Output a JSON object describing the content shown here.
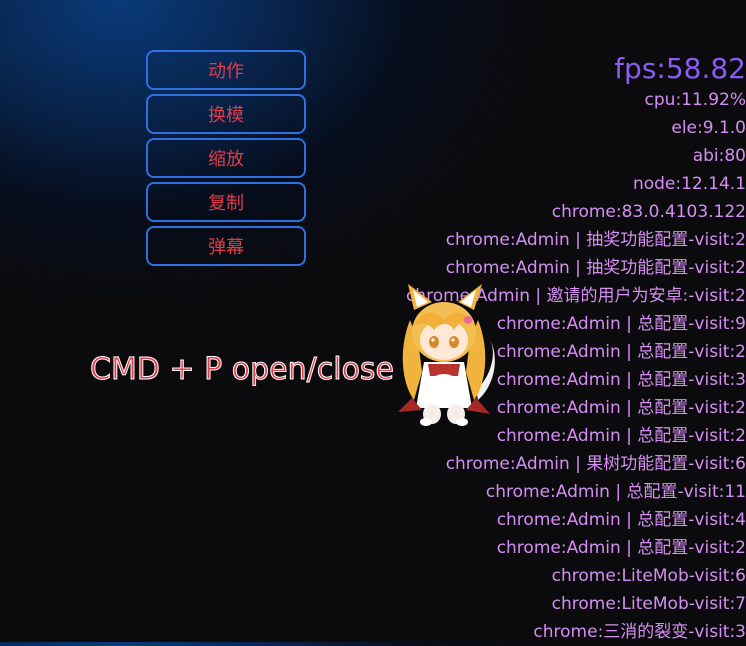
{
  "menu": {
    "items": [
      {
        "label": "动作"
      },
      {
        "label": "换模"
      },
      {
        "label": "缩放"
      },
      {
        "label": "复制"
      },
      {
        "label": "弹幕"
      }
    ]
  },
  "hint": {
    "text": "CMD + P open/close"
  },
  "stats": {
    "fps": "fps:58.82",
    "lines": [
      "cpu:11.92%",
      "ele:9.1.0",
      "abi:80",
      "node:12.14.1",
      "chrome:83.0.4103.122",
      "chrome:Admin | 抽奖功能配置-visit:2",
      "chrome:Admin | 抽奖功能配置-visit:2",
      "chrome:Admin | 邀请的用户为安卓:-visit:2",
      "chrome:Admin | 总配置-visit:9",
      "chrome:Admin | 总配置-visit:2",
      "chrome:Admin | 总配置-visit:3",
      "chrome:Admin | 总配置-visit:2",
      "chrome:Admin | 总配置-visit:2",
      "chrome:Admin | 果树功能配置-visit:6",
      "chrome:Admin | 总配置-visit:11",
      "chrome:Admin | 总配置-visit:4",
      "chrome:Admin | 总配置-visit:2",
      "chrome:LiteMob-visit:6",
      "chrome:LiteMob-visit:7",
      "chrome:三消的裂变-visit:3"
    ]
  },
  "colors": {
    "button_border": "#2f6fe0",
    "button_text": "#e23c4a",
    "fps_text": "#8a5cf0",
    "stat_text": "#d58ef2"
  }
}
